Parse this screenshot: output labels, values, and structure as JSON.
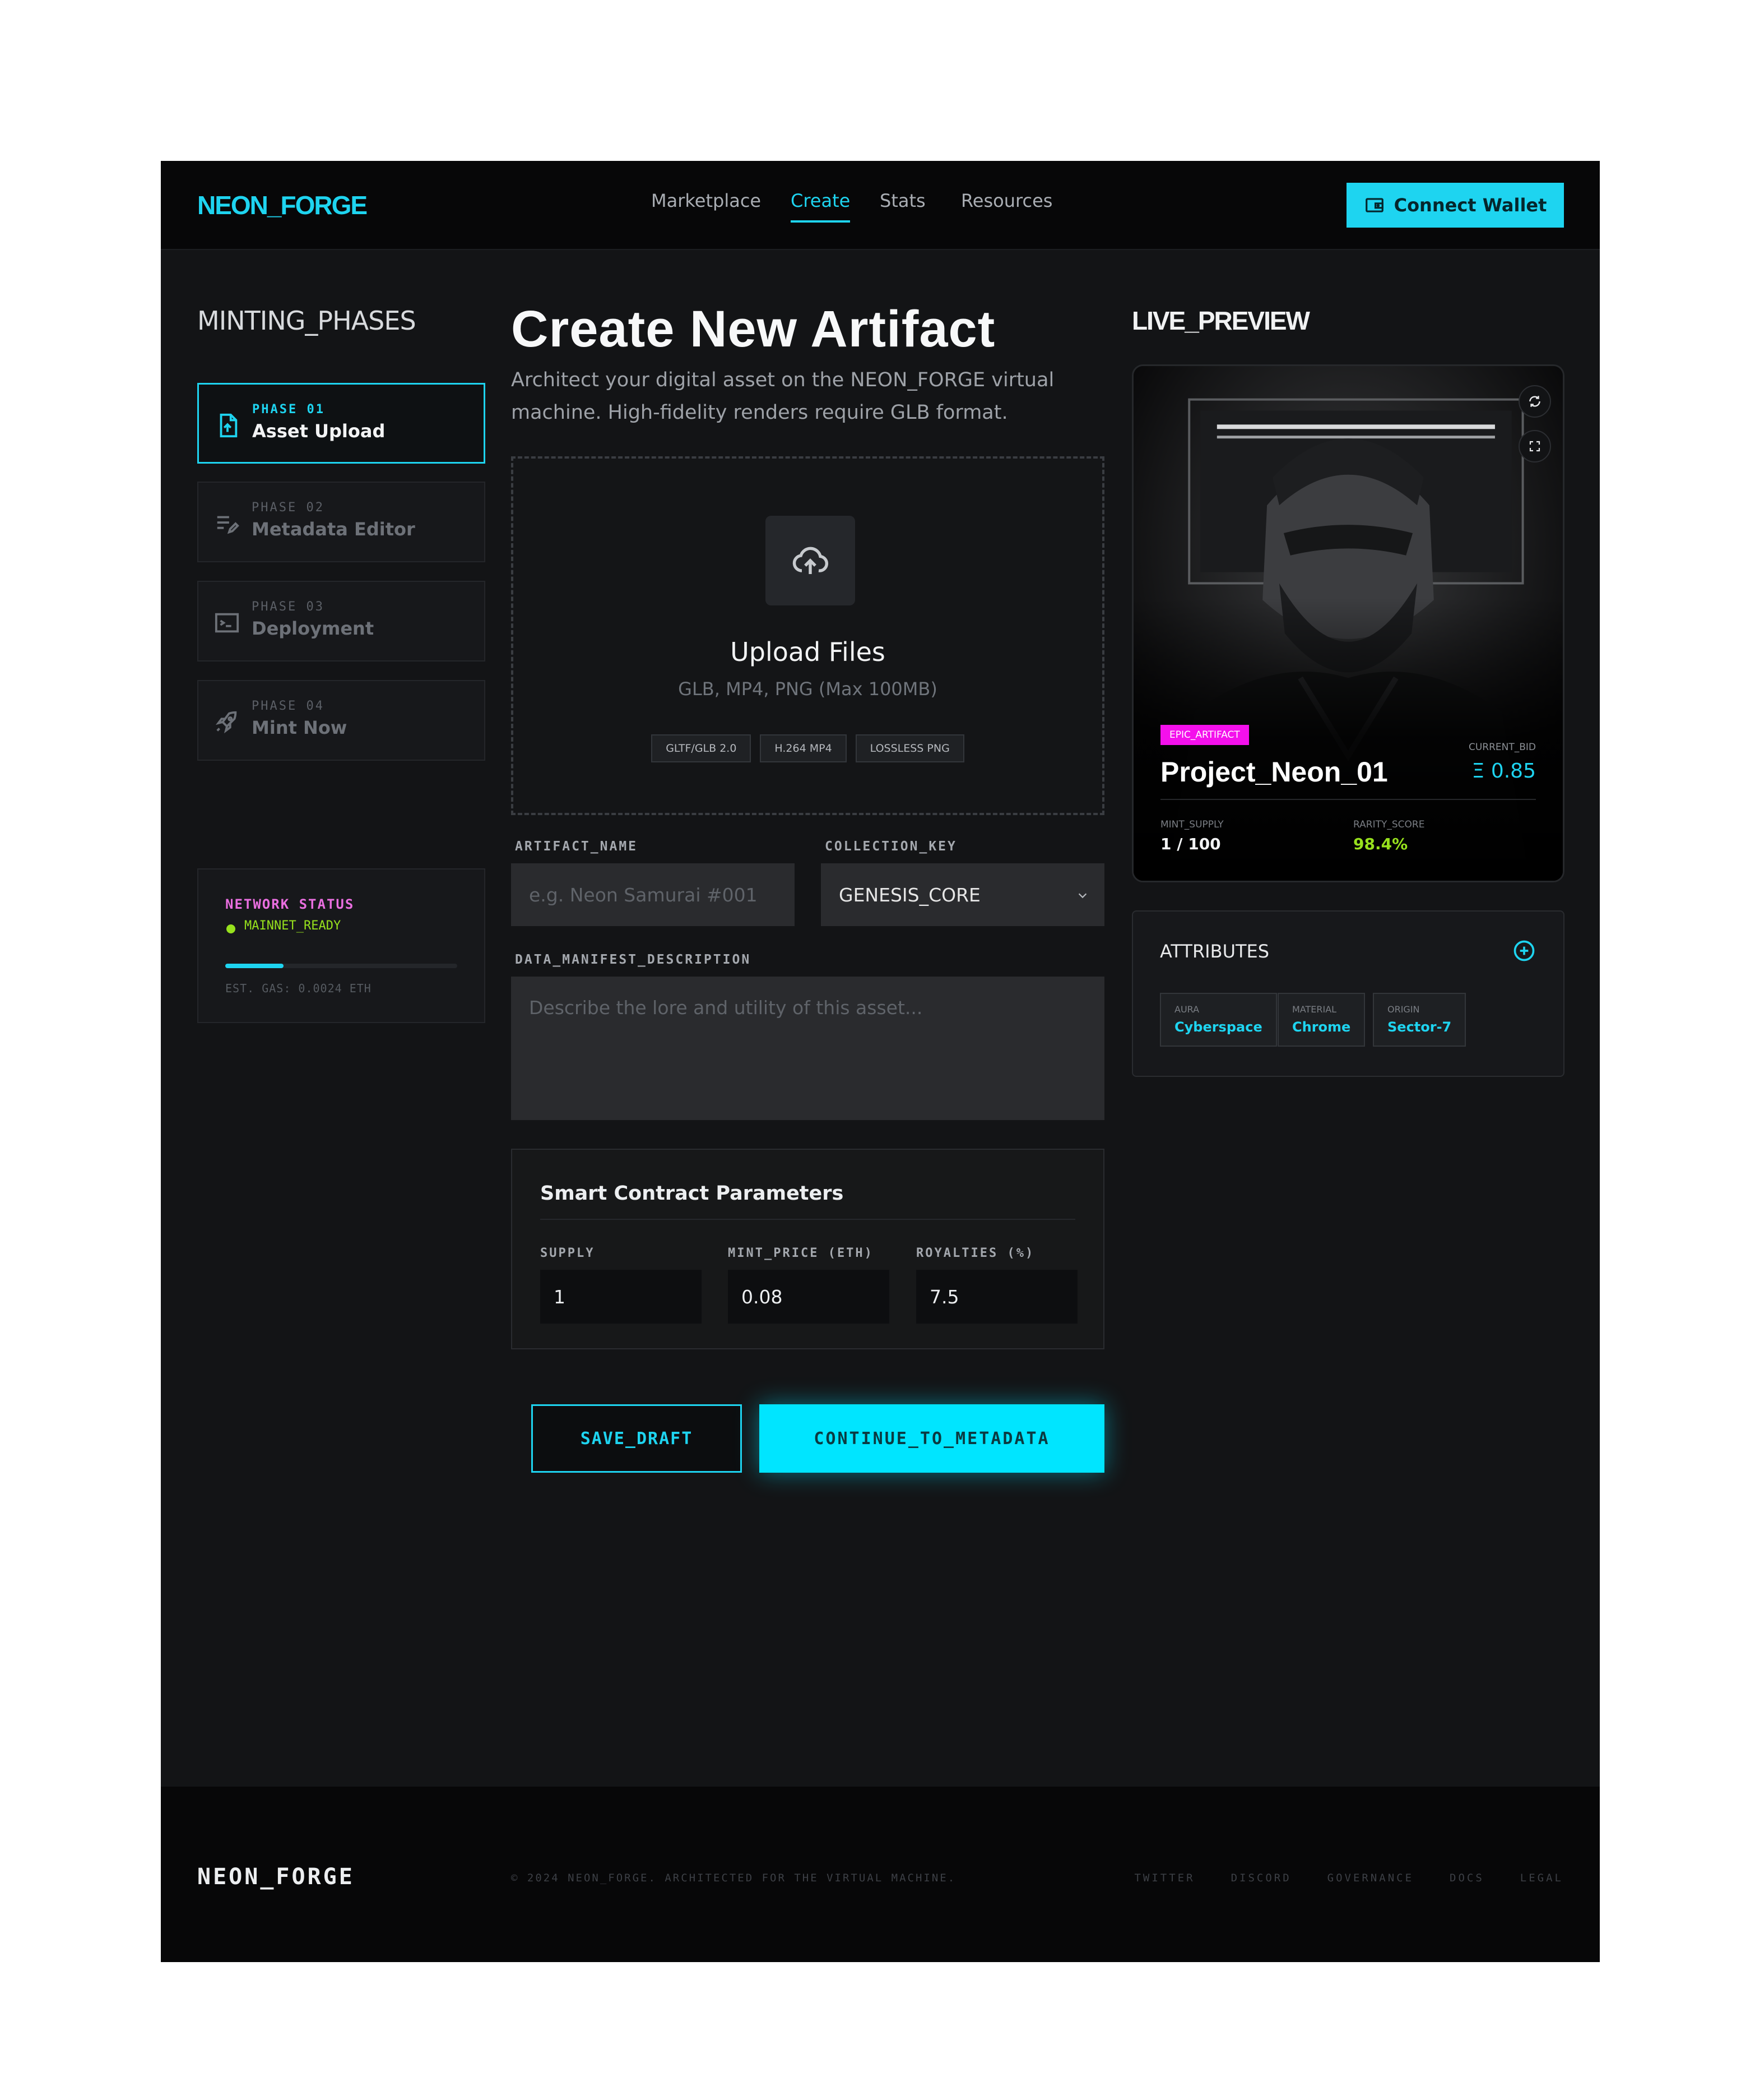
{
  "nav": {
    "logo": "NEON_FORGE",
    "links": [
      "Marketplace",
      "Create",
      "Stats",
      "Resources"
    ],
    "active_link": "Create",
    "connect_wallet": "Connect Wallet"
  },
  "sidebar": {
    "title": "MINTING_PHASES",
    "phases": [
      {
        "tag": "PHASE 01",
        "name": "Asset Upload",
        "icon": "file-upload-icon",
        "active": true
      },
      {
        "tag": "PHASE 02",
        "name": "Metadata Editor",
        "icon": "edit-list-icon",
        "active": false
      },
      {
        "tag": "PHASE 03",
        "name": "Deployment",
        "icon": "terminal-icon",
        "active": false
      },
      {
        "tag": "PHASE 04",
        "name": "Mint Now",
        "icon": "rocket-icon",
        "active": false
      }
    ],
    "network": {
      "title": "NETWORK STATUS",
      "status": "MAINNET_READY",
      "progress": 0.25,
      "gas": "EST. GAS: 0.0024 ETH"
    }
  },
  "main": {
    "title": "Create New Artifact",
    "subtitle": "Architect your digital asset on the NEON_FORGE virtual machine. High-fidelity renders require GLB format.",
    "upload": {
      "title": "Upload Files",
      "subtitle": "GLB, MP4, PNG (Max 100MB)",
      "chips": [
        "GLTF/GLB 2.0",
        "H.264 MP4",
        "LOSSLESS PNG"
      ]
    },
    "artifact_name": {
      "label": "ARTIFACT_NAME",
      "placeholder": "e.g. Neon Samurai #001"
    },
    "collection_key": {
      "label": "COLLECTION_KEY",
      "value": "GENESIS_CORE"
    },
    "description": {
      "label": "DATA_MANIFEST_DESCRIPTION",
      "placeholder": "Describe the lore and utility of this asset..."
    },
    "contract": {
      "title": "Smart Contract Parameters",
      "supply_label": "SUPPLY",
      "supply": "1",
      "price_label": "MINT_PRICE (ETH)",
      "price": "0.08",
      "royalties_label": "ROYALTIES (%)",
      "royalties": "7.5"
    },
    "save_draft": "SAVE_DRAFT",
    "continue": "CONTINUE_TO_METADATA"
  },
  "preview": {
    "title": "LIVE_PREVIEW",
    "badge": "EPIC_ARTIFACT",
    "name": "Project_Neon_01",
    "bid_label": "CURRENT_BID",
    "bid_value": "Ξ 0.85",
    "supply_label": "MINT_SUPPLY",
    "supply_value": "1 / 100",
    "rarity_label": "RARITY_SCORE",
    "rarity_value": "98.4%",
    "attributes_title": "ATTRIBUTES",
    "attributes": [
      {
        "key": "AURA",
        "value": "Cyberspace"
      },
      {
        "key": "MATERIAL",
        "value": "Chrome"
      },
      {
        "key": "ORIGIN",
        "value": "Sector-7"
      }
    ]
  },
  "footer": {
    "logo": "NEON_FORGE",
    "copyright": "© 2024 NEON_FORGE. ARCHITECTED FOR THE VIRTUAL MACHINE.",
    "links": [
      "TWITTER",
      "DISCORD",
      "GOVERNANCE",
      "DOCS",
      "LEGAL"
    ]
  },
  "colors": {
    "accent": "#1ed4f0",
    "magenta": "#f410ec",
    "lime": "#97e11d",
    "pink": "#ea6fe0"
  }
}
